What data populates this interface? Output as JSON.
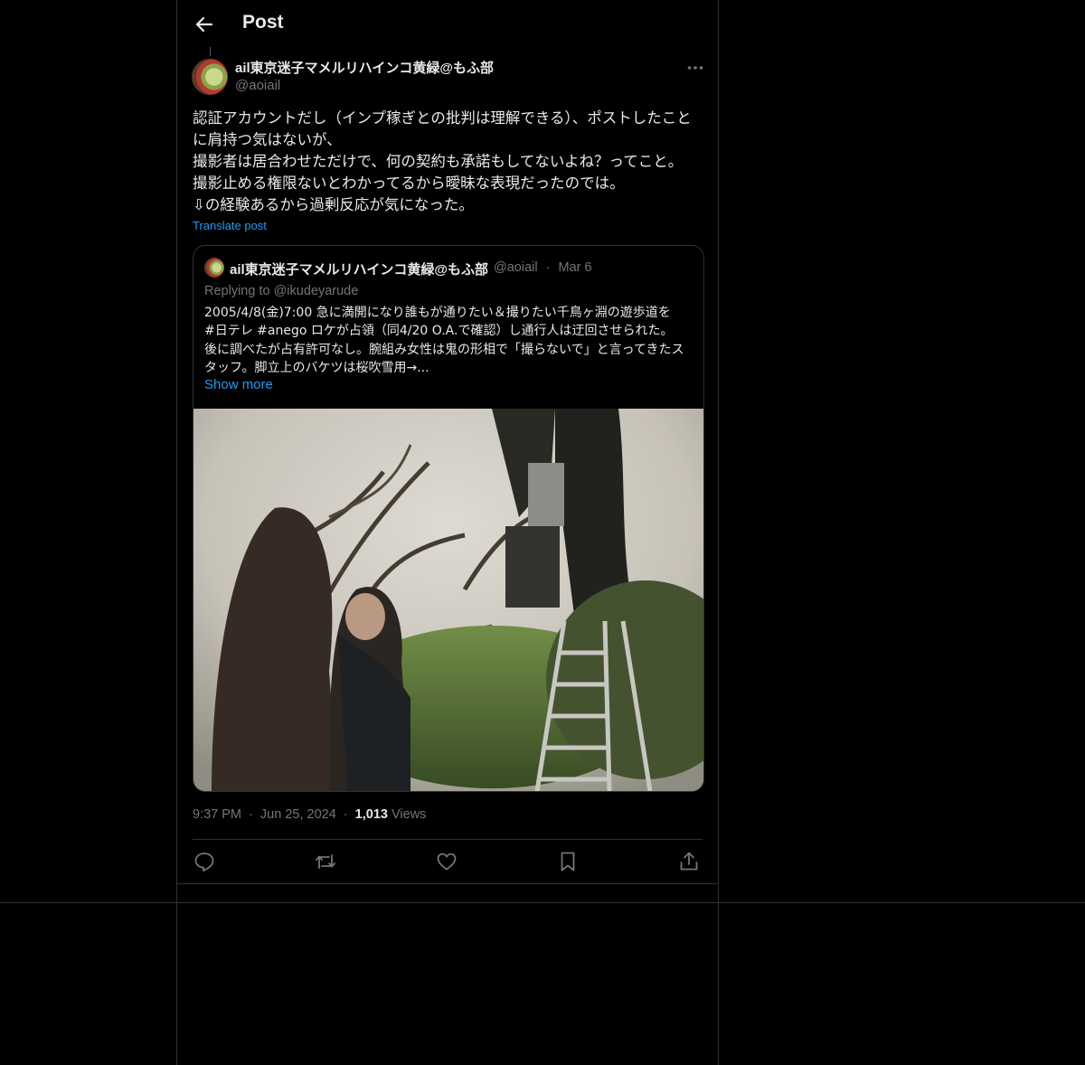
{
  "header": {
    "title": "Post",
    "back_icon": "arrow-left-icon"
  },
  "post": {
    "author_name": "ail東京迷子マメルリハインコ黄緑@もふ部",
    "author_handle": "@aoiail",
    "more_icon": "more-horizontal-icon",
    "text": "認証アカウントだし（インプ稼ぎとの批判は理解できる）、ポストしたことに肩持つ気はないが、\n撮影者は居合わせただけで、何の契約も承諾もしてないよね？ってこと。\n撮影止める権限ないとわかってるから曖昧な表現だったのでは。\n⇩の経験あるから過剰反応が気になった。",
    "translate_label": "Translate post",
    "time": "9:37 PM",
    "date": "Jun 25, 2024",
    "views_count": "1,013",
    "views_label": "Views",
    "separator": "·"
  },
  "quote": {
    "author_name": "ail東京迷子マメルリハインコ黄緑@もふ部",
    "author_handle": "@aoiail",
    "separator": "·",
    "date": "Mar 6",
    "replying_to": "Replying to @ikudeyarude",
    "text": "2005/4/8(金)7:00 急に満開になり誰もが通りたい＆撮りたい千鳥ヶ淵の遊歩道を\n#日テレ #anego ロケが占領（同4/20 O.A.で確認）し通行人は迂回させられた。\n後に調べたが占有許可なし。腕組み女性は鬼の形相で「撮らないで」と言ってきたスタッフ。脚立上のバケツは桜吹雪用→...",
    "show_more_label": "Show more",
    "media_description_icon": "photo-cherry-blossom-ladder"
  },
  "actions": [
    {
      "name": "reply-button",
      "icon": "reply-icon"
    },
    {
      "name": "repost-button",
      "icon": "repost-icon"
    },
    {
      "name": "like-button",
      "icon": "heart-icon"
    },
    {
      "name": "bookmark-button",
      "icon": "bookmark-icon"
    },
    {
      "name": "share-button",
      "icon": "share-icon"
    }
  ],
  "colors": {
    "background": "#000000",
    "text": "#e7e9ea",
    "muted": "#71767b",
    "accent": "#1d9bf0",
    "border": "#2f3336"
  }
}
